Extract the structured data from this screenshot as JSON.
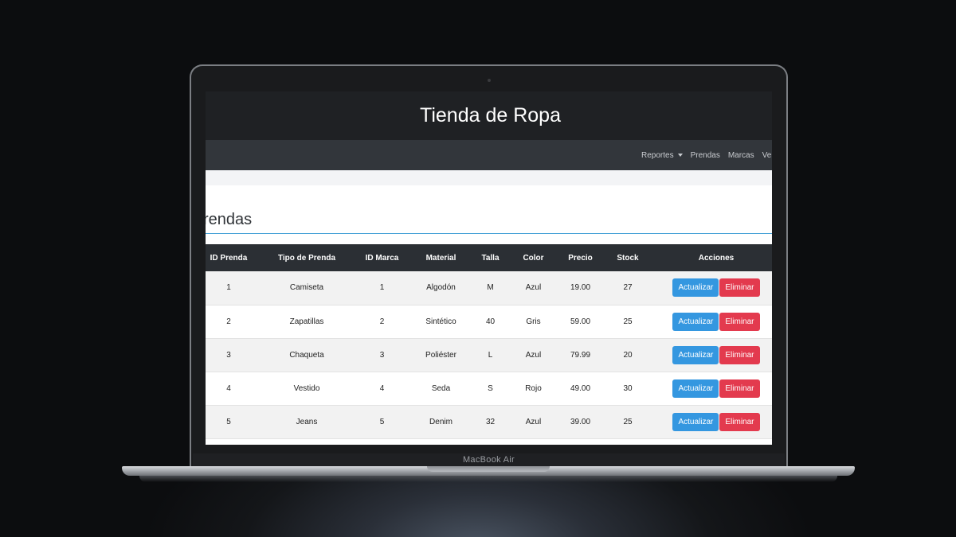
{
  "app": {
    "title": "Tienda de Ropa"
  },
  "nav": {
    "reports": "Reportes",
    "items": [
      "Prendas",
      "Marcas",
      "Ve"
    ]
  },
  "page": {
    "heading": "rendas"
  },
  "table": {
    "columns": [
      "ID Prenda",
      "Tipo de Prenda",
      "ID Marca",
      "Material",
      "Talla",
      "Color",
      "Precio",
      "Stock",
      "Acciones"
    ],
    "rows": [
      {
        "id": "1",
        "tipo": "Camiseta",
        "marca": "1",
        "material": "Algodón",
        "talla": "M",
        "color": "Azul",
        "precio": "19.00",
        "stock": "27"
      },
      {
        "id": "2",
        "tipo": "Zapatillas",
        "marca": "2",
        "material": "Sintético",
        "talla": "40",
        "color": "Gris",
        "precio": "59.00",
        "stock": "25"
      },
      {
        "id": "3",
        "tipo": "Chaqueta",
        "marca": "3",
        "material": "Poliéster",
        "talla": "L",
        "color": "Azul",
        "precio": "79.99",
        "stock": "20"
      },
      {
        "id": "4",
        "tipo": "Vestido",
        "marca": "4",
        "material": "Seda",
        "talla": "S",
        "color": "Rojo",
        "precio": "49.00",
        "stock": "30"
      },
      {
        "id": "5",
        "tipo": "Jeans",
        "marca": "5",
        "material": "Denim",
        "talla": "32",
        "color": "Azul",
        "precio": "39.00",
        "stock": "25"
      }
    ],
    "update_label": "Actualizar",
    "delete_label": "Eliminar"
  },
  "device": {
    "label": "MacBook Air"
  },
  "colors": {
    "header_bg": "#1f2124",
    "navbar_bg": "#32363b",
    "update_button": "#3497e0",
    "delete_button": "#e33a4e",
    "accent_rule": "#4aa3d8"
  }
}
